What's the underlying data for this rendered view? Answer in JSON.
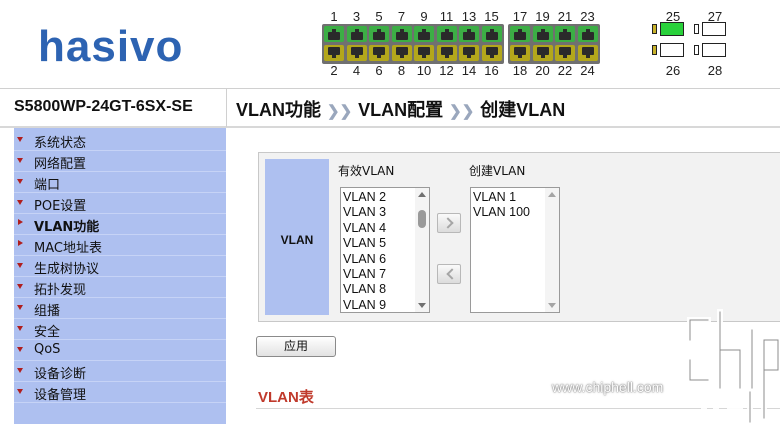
{
  "header": {
    "brand": "hasivo",
    "ports_top": [
      "1",
      "3",
      "5",
      "7",
      "9",
      "11",
      "13",
      "15",
      "17",
      "19",
      "21",
      "23"
    ],
    "ports_bottom": [
      "2",
      "4",
      "6",
      "8",
      "10",
      "12",
      "14",
      "16",
      "18",
      "20",
      "22",
      "24"
    ],
    "sfp_top": [
      "25",
      "27"
    ],
    "sfp_bottom": [
      "26",
      "28"
    ]
  },
  "titlebar": {
    "model": "S5800WP-24GT-6SX-SE",
    "breadcrumb": [
      "VLAN功能",
      "VLAN配置",
      "创建VLAN"
    ],
    "separator": "❯❯"
  },
  "sidebar": {
    "items": [
      {
        "label": "系统状态",
        "expanded": true
      },
      {
        "label": "网络配置",
        "expanded": true
      },
      {
        "label": "端口",
        "expanded": true
      },
      {
        "label": "POE设置",
        "expanded": true
      },
      {
        "label": "VLAN功能",
        "expanded": false,
        "active": true
      },
      {
        "label": "MAC地址表",
        "expanded": false
      },
      {
        "label": "生成树协议",
        "expanded": true
      },
      {
        "label": "拓扑发现",
        "expanded": true
      },
      {
        "label": "组播",
        "expanded": true
      },
      {
        "label": "安全",
        "expanded": true
      },
      {
        "label": "QoS",
        "expanded": true
      },
      {
        "label": "设备诊断",
        "expanded": true
      },
      {
        "label": "设备管理",
        "expanded": true
      }
    ]
  },
  "main": {
    "row_label": "VLAN",
    "available_title": "有效VLAN",
    "available": [
      "VLAN 2",
      "VLAN 3",
      "VLAN 4",
      "VLAN 5",
      "VLAN 6",
      "VLAN 7",
      "VLAN 8",
      "VLAN 9"
    ],
    "created_title": "创建VLAN",
    "created": [
      "VLAN 1",
      "VLAN 100"
    ],
    "apply_label": "应用",
    "table_title": "VLAN表"
  },
  "watermark": {
    "url": "www.chiphell.com"
  },
  "colors": {
    "brand": "#2d63b2",
    "sidebar": "#aec0f0",
    "port_green": "#3cae45",
    "port_yellow": "#b3a71b",
    "accent_red": "#c0392b"
  }
}
